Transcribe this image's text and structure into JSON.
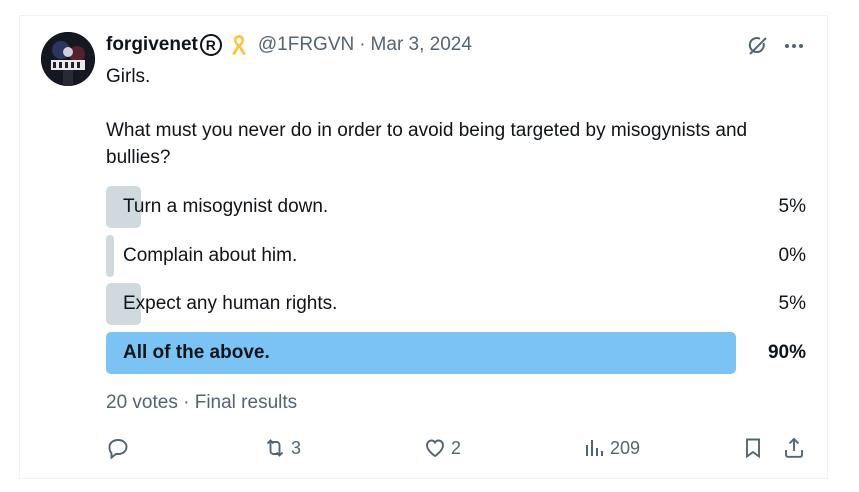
{
  "post": {
    "display_name": "forgivenet",
    "registered_mark": "R",
    "handle": "@1FRGVN",
    "separator": "·",
    "date": "Mar 3, 2024",
    "text_line1": "Girls.",
    "text_line2": "What must you never do in order to avoid being targeted by misogynists and bullies?"
  },
  "poll": {
    "options": [
      {
        "label": "Turn a misogynist down.",
        "percent_text": "5%",
        "fraction": 0.05
      },
      {
        "label": "Complain about him.",
        "percent_text": "0%",
        "fraction": 0.0
      },
      {
        "label": "Expect any human rights.",
        "percent_text": "5%",
        "fraction": 0.05
      },
      {
        "label": "All of the above.",
        "percent_text": "90%",
        "fraction": 0.9
      }
    ],
    "summary": "20 votes · Final results"
  },
  "actions": {
    "reply_count": "",
    "repost_count": "3",
    "like_count": "2",
    "views_count": "209"
  },
  "colors": {
    "winner_bar": "#7cc3f5",
    "bar": "#cfd9de",
    "secondary_text": "#536471",
    "ribbon": "#f7c548"
  },
  "icons": [
    "grok-icon",
    "more-icon",
    "reply-icon",
    "repost-icon",
    "like-icon",
    "views-icon",
    "bookmark-icon",
    "share-icon",
    "ribbon-icon"
  ]
}
